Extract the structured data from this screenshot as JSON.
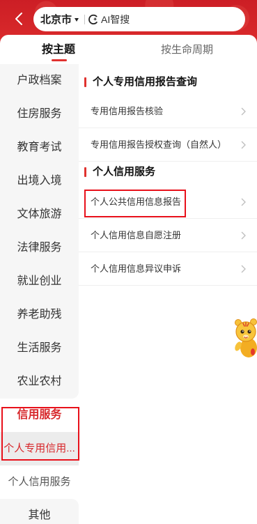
{
  "header": {
    "back_icon": "chevron-left-icon",
    "location": {
      "city": "北京市",
      "dropdown_icon": "caret-down-icon"
    },
    "search": {
      "icon": "ai-search-icon",
      "label": "AI智搜"
    }
  },
  "tabs": [
    {
      "label": "按主题",
      "active": true
    },
    {
      "label": "按生命周期",
      "active": false
    }
  ],
  "sidebar": {
    "categories": [
      {
        "label": "户政档案"
      },
      {
        "label": "住房服务"
      },
      {
        "label": "教育考试"
      },
      {
        "label": "出境入境"
      },
      {
        "label": "文体旅游"
      },
      {
        "label": "法律服务"
      },
      {
        "label": "就业创业"
      },
      {
        "label": "养老助残"
      },
      {
        "label": "生活服务"
      },
      {
        "label": "农业农村"
      },
      {
        "label": "信用服务",
        "selected": true,
        "sub_items": [
          {
            "label": "个人专用信用...",
            "selected": true
          },
          {
            "label": "个人信用服务",
            "selected": false
          }
        ]
      },
      {
        "label": "其他"
      }
    ]
  },
  "content": {
    "row_icon": "chevron-right-icon",
    "sections": [
      {
        "title": "个人专用信用报告查询",
        "items": [
          {
            "label": "专用信用报告核验"
          },
          {
            "label": "专用信用报告授权查询（自然人）"
          }
        ]
      },
      {
        "title": "个人信用服务",
        "items": [
          {
            "label": "个人公共信用信息报告",
            "highlighted": true
          },
          {
            "label": "个人信用信息自愿注册"
          },
          {
            "label": "个人信用信息异议申诉"
          }
        ]
      }
    ]
  },
  "floating_assistant": {
    "icon": "mascot-tiger-icon"
  },
  "colors": {
    "header_red": "#d42529",
    "accent_red": "#e0322f",
    "selected_text_red": "#d7282c",
    "highlight_box_red": "#e8101a",
    "sidebar_bg": "#f6f6f6"
  }
}
